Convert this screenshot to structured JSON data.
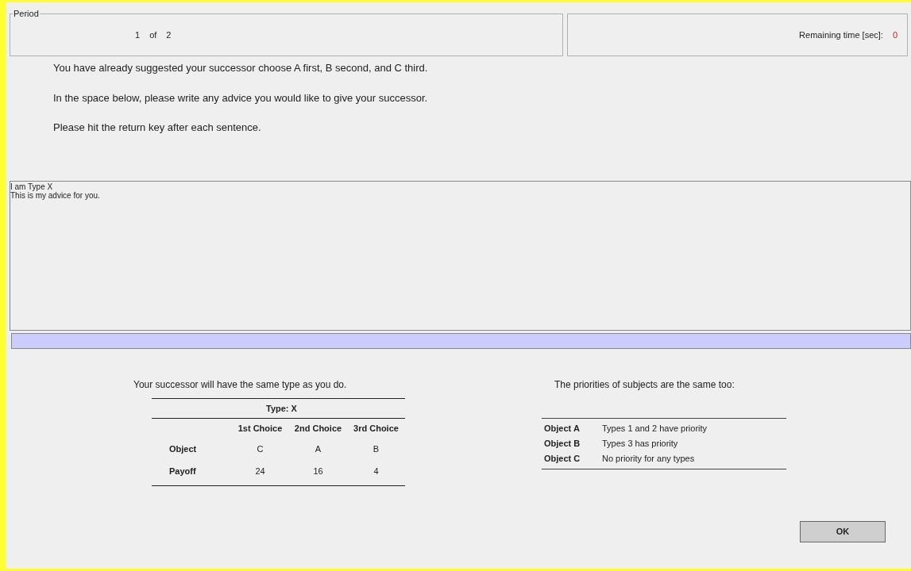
{
  "period": {
    "legend": "Period",
    "current": "1",
    "of": "of",
    "total": "2"
  },
  "timer": {
    "label": "Remaining time [sec]:",
    "value": "0"
  },
  "instructions": [
    "You have already suggested your successor choose  A first, B second, and C third.",
    "In the space below, please write any advice you would like to give your successor.",
    "Please hit the return key after each sentence."
  ],
  "advice_log": [
    "I am Type  X",
    "This is my advice for you."
  ],
  "type_table": {
    "caption": "Your successor will have the same type as you do.",
    "header": "Type: X",
    "columns": [
      "1st Choice",
      "2nd Choice",
      "3rd Choice"
    ],
    "rows": [
      {
        "label": "Object",
        "cells": [
          "C",
          "A",
          "B"
        ]
      },
      {
        "label": "Payoff",
        "cells": [
          "24",
          "16",
          "4"
        ]
      }
    ]
  },
  "priority_table": {
    "caption": "The  priorities of subjects are the same too:",
    "rows": [
      {
        "object": "Object A",
        "priority": "Types 1 and 2 have priority"
      },
      {
        "object": "Object B",
        "priority": "Types 3 has priority"
      },
      {
        "object": "Object C",
        "priority": "No priority  for any types"
      }
    ]
  },
  "ok_button": "OK"
}
